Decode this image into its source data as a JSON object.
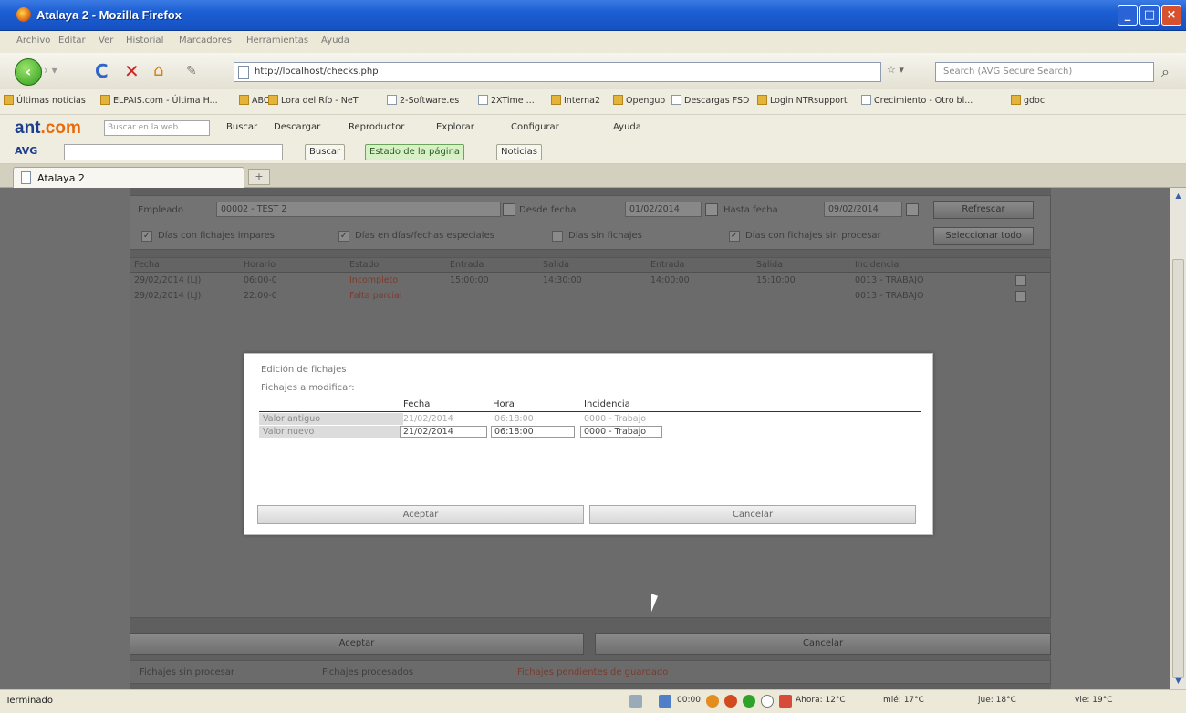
{
  "window": {
    "title": "Atalaya 2 - Mozilla Firefox"
  },
  "menu": [
    "Archivo",
    "Editar",
    "Ver",
    "Historial",
    "Marcadores",
    "Herramientas",
    "Ayuda"
  ],
  "nav": {
    "url": "http://localhost/checks.php",
    "search_placeholder": "Search (AVG Secure Search)"
  },
  "bookmarks": [
    "Últimas noticias",
    "ELPAIS.com - Última H...",
    "ABC",
    "Lora del Río - NeT",
    "2-Software.es",
    "2XTime ...",
    "Interna2",
    "Openguo",
    "Descargas FSD",
    "Login NTRsupport",
    "Crecimiento - Otro bl...",
    "gdoc"
  ],
  "ant_toolbar": {
    "logo_a": "ant",
    "logo_b": ".com",
    "search_placeholder": "Buscar en la web",
    "items": [
      "Buscar",
      "Descargar",
      "Reproductor",
      "Explorar",
      "Configurar",
      "Ayuda"
    ]
  },
  "avg_toolbar": {
    "logo": "AVG",
    "buttons": [
      "Buscar",
      "Estado de la página",
      "Noticias"
    ]
  },
  "tab": {
    "label": "Atalaya 2",
    "new_tab": "+"
  },
  "app": {
    "filters": {
      "employee_label": "Empleado",
      "employee_value": "00002 - TEST 2",
      "from_label": "Desde fecha",
      "from_value": "01/02/2014",
      "to_label": "Hasta fecha",
      "to_value": "09/02/2014",
      "refresh": "Refrescar",
      "select_all": "Seleccionar todo",
      "checks": [
        {
          "label": "Días con fichajes impares",
          "checked": true
        },
        {
          "label": "Días en días/fechas especiales",
          "checked": true
        },
        {
          "label": "Días sin fichajes",
          "checked": false
        },
        {
          "label": "Días con fichajes sin procesar",
          "checked": true
        }
      ]
    },
    "grid": {
      "headers": [
        "Fecha",
        "Horario",
        "Estado",
        "Entrada",
        "Salida",
        "Entrada",
        "Salida",
        "Incidencia"
      ],
      "rows": [
        [
          "29/02/2014 (LJ)",
          "06:00-0",
          "Incompleto",
          "15:00:00",
          "14:30:00",
          "14:00:00",
          "15:10:00",
          "0013 - TRABAJO"
        ],
        [
          "29/02/2014 (LJ)",
          "22:00-0",
          "Falta parcial",
          "",
          "",
          "",
          "",
          "0013 - TRABAJO"
        ]
      ]
    },
    "bottom": {
      "accept": "Aceptar",
      "cancel": "Cancelar"
    },
    "status_strip": [
      "Fichajes sin procesar",
      "Fichajes procesados",
      "Fichajes pendientes de guardado"
    ]
  },
  "modal": {
    "title": "Edición de fichajes",
    "subtitle": "Fichajes a modificar:",
    "headers": {
      "date": "Fecha",
      "time": "Hora",
      "incident": "Incidencia"
    },
    "rows": [
      {
        "label": "Valor antiguo",
        "date": "21/02/2014",
        "time": "06:18:00",
        "incident": "0000 - Trabajo"
      },
      {
        "label": "Valor nuevo",
        "date": "21/02/2014",
        "time": "06:18:00",
        "incident": "0000 - Trabajo"
      }
    ],
    "accept": "Aceptar",
    "cancel": "Cancelar"
  },
  "statusbar": {
    "left": "Terminado",
    "time": "00:00",
    "weather": [
      "Ahora: 12°C",
      "mié: 17°C",
      "jue: 18°C",
      "vie: 19°C"
    ]
  }
}
